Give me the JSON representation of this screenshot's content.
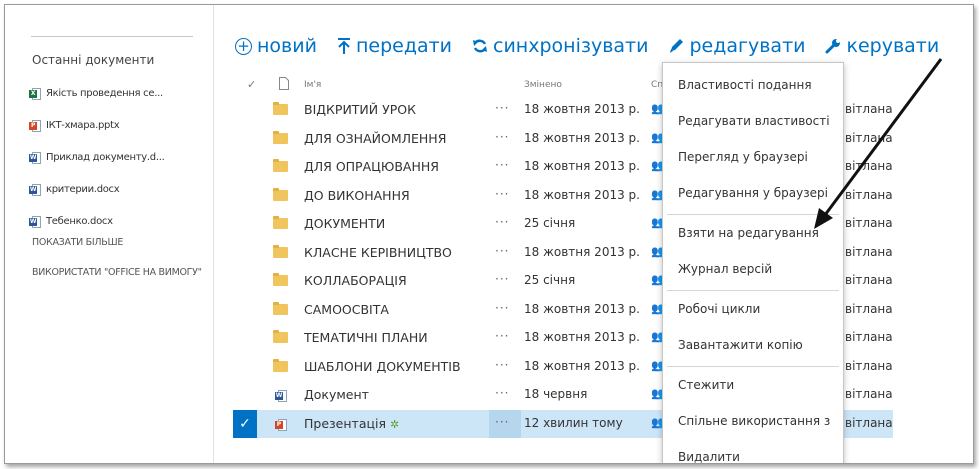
{
  "sidebar": {
    "title": "Останні документи",
    "recent": [
      {
        "name": "Якість проведення се...",
        "type": "x"
      },
      {
        "name": "ІКТ-хмара.pptx",
        "type": "p"
      },
      {
        "name": "Приклад документу.d...",
        "type": "w"
      },
      {
        "name": "критерии.docx",
        "type": "w"
      },
      {
        "name": "Тебенко.docx",
        "type": "w"
      }
    ],
    "show_more": "ПОКАЗАТИ БІЛЬШЕ",
    "office_on_demand": "ВИКОРИСТАТИ \"OFFICE НА ВИМОГУ\""
  },
  "toolbar": {
    "new": "новий",
    "upload": "передати",
    "sync": "синхронізувати",
    "edit": "редагувати",
    "manage": "керувати"
  },
  "columns": {
    "name": "Ім'я",
    "modified": "Змінено",
    "shared": "Сп"
  },
  "files": [
    {
      "name": "ВІДКРИТИЙ УРОК",
      "modified": "18 жовтня 2013 р.",
      "by": "вітлана",
      "kind": "folder"
    },
    {
      "name": "ДЛЯ ОЗНАЙОМЛЕННЯ",
      "modified": "18 жовтня 2013 р.",
      "by": "вітлана",
      "kind": "folder"
    },
    {
      "name": "ДЛЯ ОПРАЦЮВАННЯ",
      "modified": "18 жовтня 2013 р.",
      "by": "вітлана",
      "kind": "folder"
    },
    {
      "name": "ДО ВИКОНАННЯ",
      "modified": "18 жовтня 2013 р.",
      "by": "вітлана",
      "kind": "folder"
    },
    {
      "name": "ДОКУМЕНТИ",
      "modified": "25 січня",
      "by": "вітлана",
      "kind": "folder"
    },
    {
      "name": "КЛАСНЕ КЕРІВНИЦТВО",
      "modified": "18 жовтня 2013 р.",
      "by": "вітлана",
      "kind": "folder"
    },
    {
      "name": "КОЛЛАБОРАЦІЯ",
      "modified": "25 січня",
      "by": "вітлана",
      "kind": "folder"
    },
    {
      "name": "САМООСВІТА",
      "modified": "18 жовтня 2013 р.",
      "by": "вітлана",
      "kind": "folder"
    },
    {
      "name": "ТЕМАТИЧНІ ПЛАНИ",
      "modified": "18 жовтня 2013 р.",
      "by": "вітлана",
      "kind": "folder"
    },
    {
      "name": "ШАБЛОНИ ДОКУМЕНТІВ",
      "modified": "18 жовтня 2013 р.",
      "by": "вітлана",
      "kind": "folder"
    },
    {
      "name": "Документ",
      "modified": "18 червня",
      "by": "вітлана",
      "kind": "word"
    },
    {
      "name": "Презентація",
      "modified": "12 хвилин тому",
      "by": "вітлана",
      "kind": "ppt",
      "selected": true
    }
  ],
  "context_menu": {
    "groups": [
      [
        "Властивості подання",
        "Редагувати властивості",
        "Перегляд у браузері",
        "Редагування у браузері"
      ],
      [
        "Взяти на редагування",
        "Журнал версій"
      ],
      [
        "Робочі цикли",
        "Завантажити копію"
      ],
      [
        "Стежити",
        "Спільне використання з",
        "Видалити"
      ]
    ]
  },
  "icons": {
    "new": "circle-plus-icon",
    "upload": "upload-arrow-icon",
    "sync": "sync-icon",
    "edit": "pencil-icon",
    "manage": "wrench-icon",
    "shared": "people-icon",
    "callout": "arrow-annotation"
  },
  "colors": {
    "accent": "#0072c6",
    "selected_row": "#cde6f7",
    "folder": "#f0c55e"
  }
}
